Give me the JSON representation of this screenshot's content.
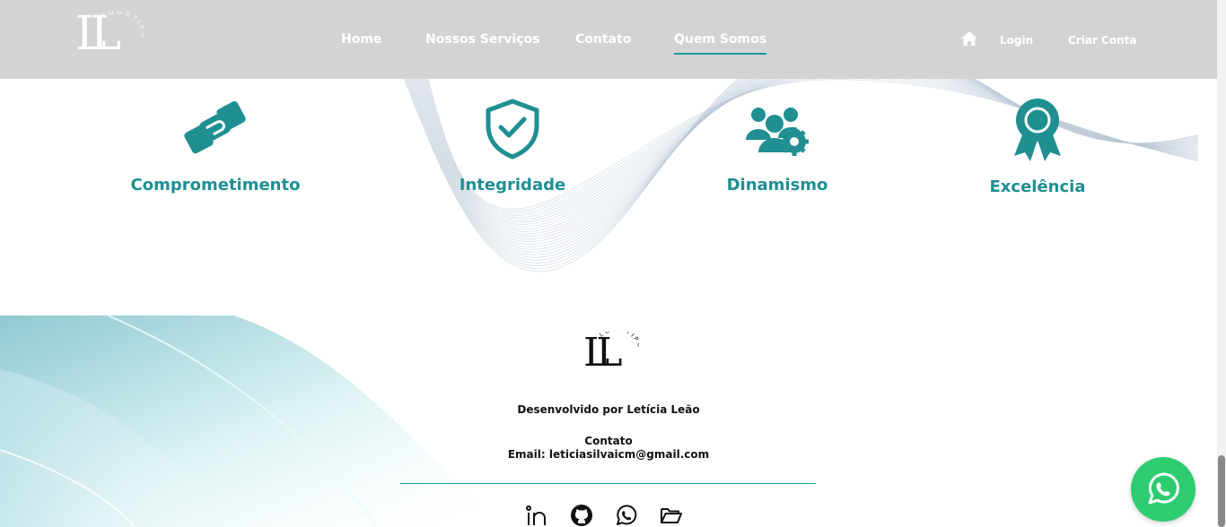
{
  "header": {
    "logo_text": "LL",
    "logo_ring_text": "LOGOTIPO",
    "nav": [
      {
        "label": "Home"
      },
      {
        "label": "Nossos Serviços"
      },
      {
        "label": "Contato"
      },
      {
        "label": "Quem Somos",
        "active": true
      }
    ],
    "account": {
      "login_label": "Login",
      "signup_label": "Criar Conta",
      "home_icon": "home-icon"
    }
  },
  "values": [
    {
      "label": "Comprometimento",
      "icon": "handshake-icon"
    },
    {
      "label": "Integridade",
      "icon": "shield-check-icon"
    },
    {
      "label": "Dinamismo",
      "icon": "team-gear-icon"
    },
    {
      "label": "Excelência",
      "icon": "award-ribbon-icon"
    }
  ],
  "footer": {
    "logo_text": "LL",
    "logo_ring_text": "LOGOTIPO",
    "developed_by": "Desenvolvido por Letícia Leão",
    "contact_title": "Contato",
    "contact_email": "Email: leticiasilvaicm@gmail.com",
    "social_icons": [
      "linkedin-icon",
      "github-icon",
      "whatsapp-icon",
      "folder-icon"
    ]
  },
  "floating": {
    "whatsapp_icon": "whatsapp-icon"
  },
  "colors": {
    "accent": "#1f8f92",
    "header_bg": "#d3d3d3",
    "whatsapp": "#2ecc71"
  }
}
